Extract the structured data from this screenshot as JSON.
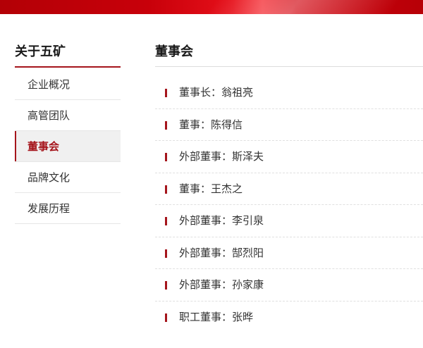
{
  "sidebar": {
    "title": "关于五矿",
    "items": [
      {
        "label": "企业概况"
      },
      {
        "label": "高管团队"
      },
      {
        "label": "董事会",
        "active": true
      },
      {
        "label": "品牌文化"
      },
      {
        "label": "发展历程"
      }
    ]
  },
  "main": {
    "title": "董事会",
    "members": [
      "董事长：翁祖亮",
      "董事：陈得信",
      "外部董事：斯泽夫",
      "董事：王杰之",
      "外部董事：李引泉",
      "外部董事：郜烈阳",
      "外部董事：孙家康",
      "职工董事：张晔"
    ]
  },
  "colors": {
    "accent": "#a5151c",
    "banner": "#d0000b",
    "active_bg": "#f0f0f0"
  }
}
